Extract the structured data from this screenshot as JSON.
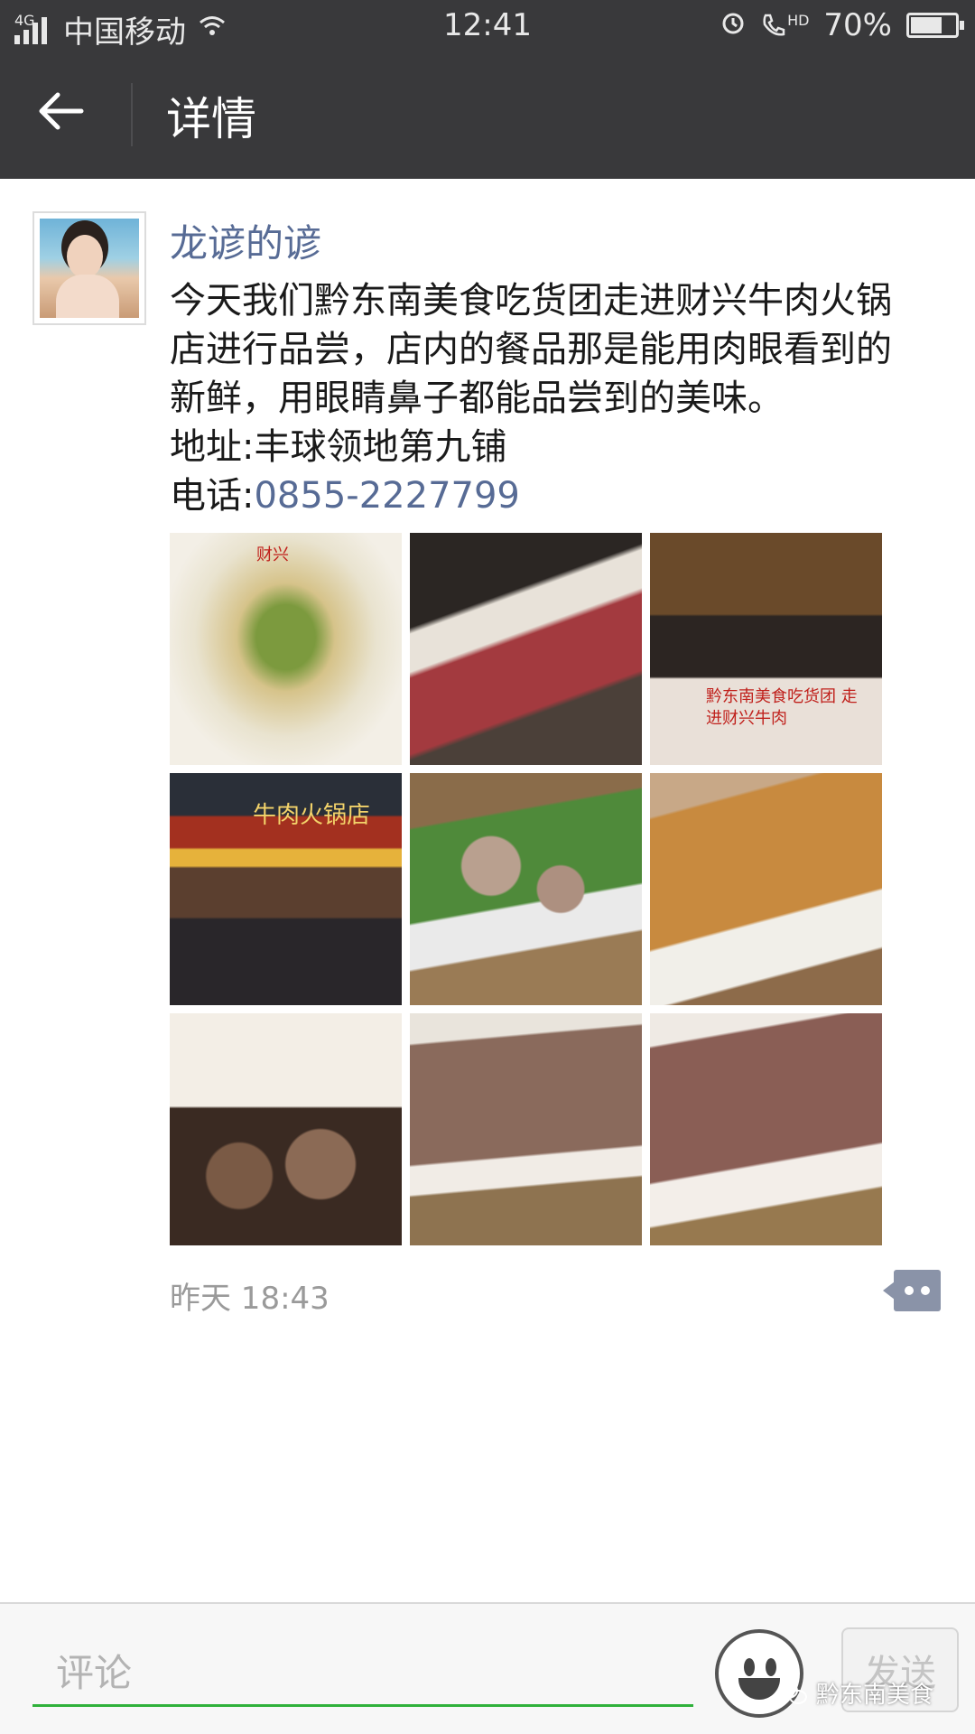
{
  "status_bar": {
    "network_type": "4G",
    "carrier": "中国移动",
    "time": "12:41",
    "battery": "70%",
    "battery_level": 0.7,
    "hd_label": "HD"
  },
  "title_bar": {
    "title": "详情"
  },
  "post": {
    "author": "龙谚的谚",
    "text_lines": [
      "今天我们黔东南美食吃货团走进财兴牛肉火锅",
      "店进行品尝，店内的餐品那是能用肉眼看到的",
      "新鲜，用眼睛鼻子都能品尝到的美味。"
    ],
    "address": "地址:丰球领地第九铺",
    "phone_label": "电话:",
    "phone": "0855-2227799",
    "photos": [
      {
        "icon": "food-photo-icon",
        "overlay": "财兴"
      },
      {
        "icon": "food-photo-icon",
        "overlay": ""
      },
      {
        "icon": "group-photo-icon",
        "overlay": "黔东南美食吃货团 走进财兴牛肉"
      },
      {
        "icon": "storefront-photo-icon",
        "overlay": "牛肉火锅店"
      },
      {
        "icon": "food-photo-icon",
        "overlay": ""
      },
      {
        "icon": "food-photo-icon",
        "overlay": ""
      },
      {
        "icon": "food-photo-icon",
        "overlay": ""
      },
      {
        "icon": "food-photo-icon",
        "overlay": ""
      },
      {
        "icon": "food-photo-icon",
        "overlay": ""
      }
    ],
    "time": "昨天 18:43"
  },
  "input_bar": {
    "placeholder": "评论",
    "send_label": "发送"
  },
  "watermark": {
    "text": "黔东南美食"
  },
  "colors": {
    "bar_bg": "#39393b",
    "link": "#576b95",
    "input_underline": "#2fb13b"
  }
}
